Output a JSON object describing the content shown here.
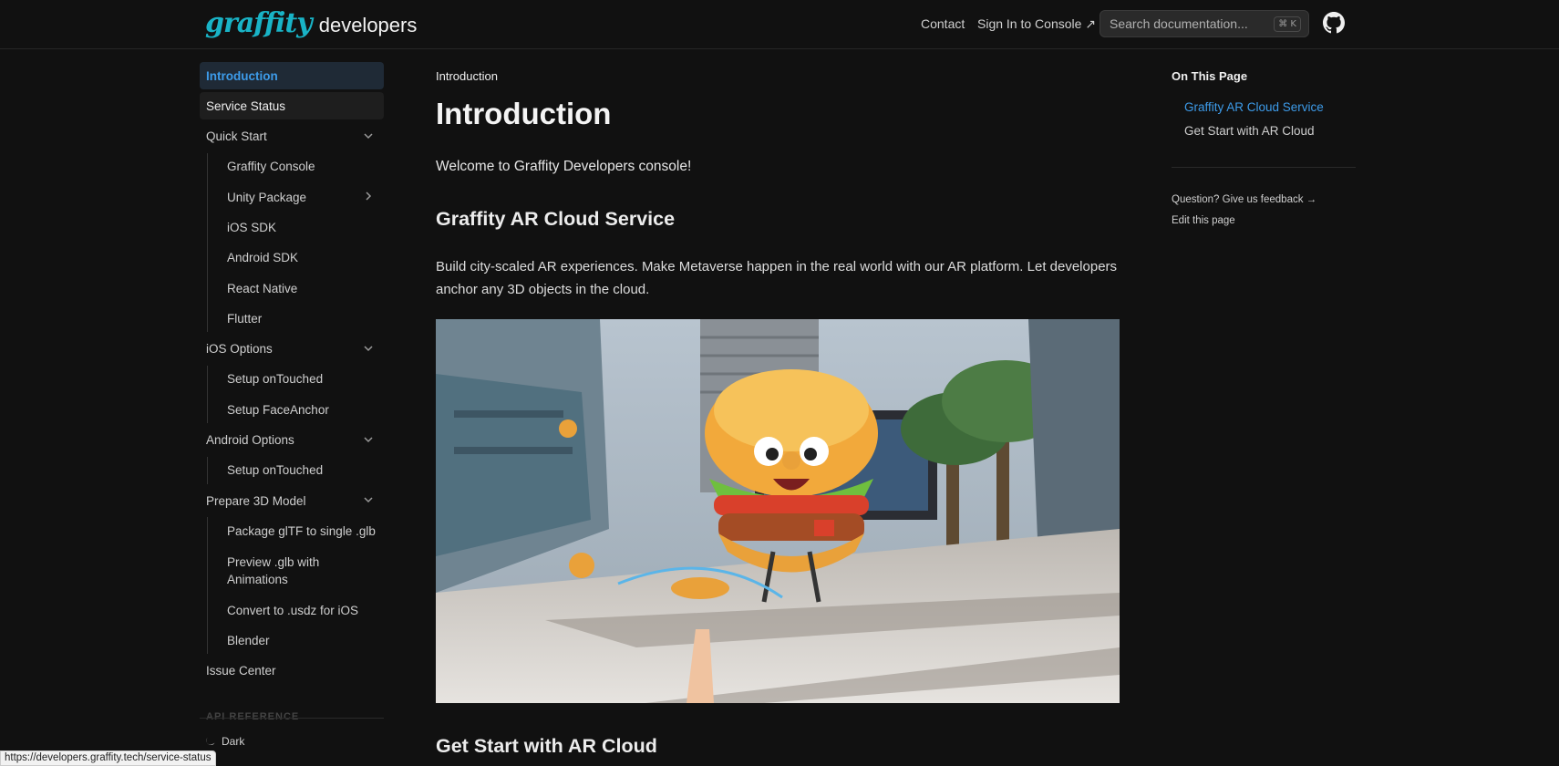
{
  "header": {
    "logo_script": "graffity",
    "logo_text": "developers",
    "nav": {
      "contact": "Contact",
      "sign_in": "Sign In to Console ↗"
    },
    "search": {
      "placeholder": "Search documentation...",
      "shortcut": "⌘ K"
    },
    "github_icon": "github-icon"
  },
  "sidebar": {
    "items": [
      {
        "label": "Introduction",
        "state": "active"
      },
      {
        "label": "Service Status",
        "state": "hover"
      },
      {
        "label": "Quick Start",
        "expandable": "expanded"
      },
      {
        "label": "Graffity Console"
      },
      {
        "label": "Unity Package",
        "expandable": "collapsed"
      },
      {
        "label": "iOS SDK"
      },
      {
        "label": "Android SDK"
      },
      {
        "label": "React Native"
      },
      {
        "label": "Flutter"
      },
      {
        "label": "iOS Options",
        "expandable": "expanded"
      },
      {
        "label": "Setup onTouched"
      },
      {
        "label": "Setup FaceAnchor"
      },
      {
        "label": "Android Options",
        "expandable": "expanded"
      },
      {
        "label": "Setup onTouched"
      },
      {
        "label": "Prepare 3D Model",
        "expandable": "expanded"
      },
      {
        "label": "Package glTF to single .glb"
      },
      {
        "label": "Preview .glb with Animations"
      },
      {
        "label": "Convert to .usdz for iOS"
      },
      {
        "label": "Blender"
      },
      {
        "label": "Issue Center"
      }
    ],
    "section_label": "API REFERENCE",
    "theme_label": "Dark"
  },
  "status_bar_url": "https://developers.graffity.tech/service-status",
  "main": {
    "breadcrumb": "Introduction",
    "title": "Introduction",
    "welcome": "Welcome to Graffity Developers console!",
    "section1_title": "Graffity AR Cloud Service",
    "section1_body": "Build city-scaled AR experiences. Make Metaverse happen in the real world with our AR platform. Let developers anchor any 3D objects in the cloud.",
    "section2_title": "Get Start with AR Cloud"
  },
  "toc": {
    "title": "On This Page",
    "links": [
      "Graffity AR Cloud Service",
      "Get Start with AR Cloud"
    ],
    "feedback": "Question? Give us feedback →",
    "edit": "Edit this page"
  },
  "colors": {
    "background": "#111111",
    "accent": "#3d9be9",
    "logo": "#19b3c6"
  }
}
